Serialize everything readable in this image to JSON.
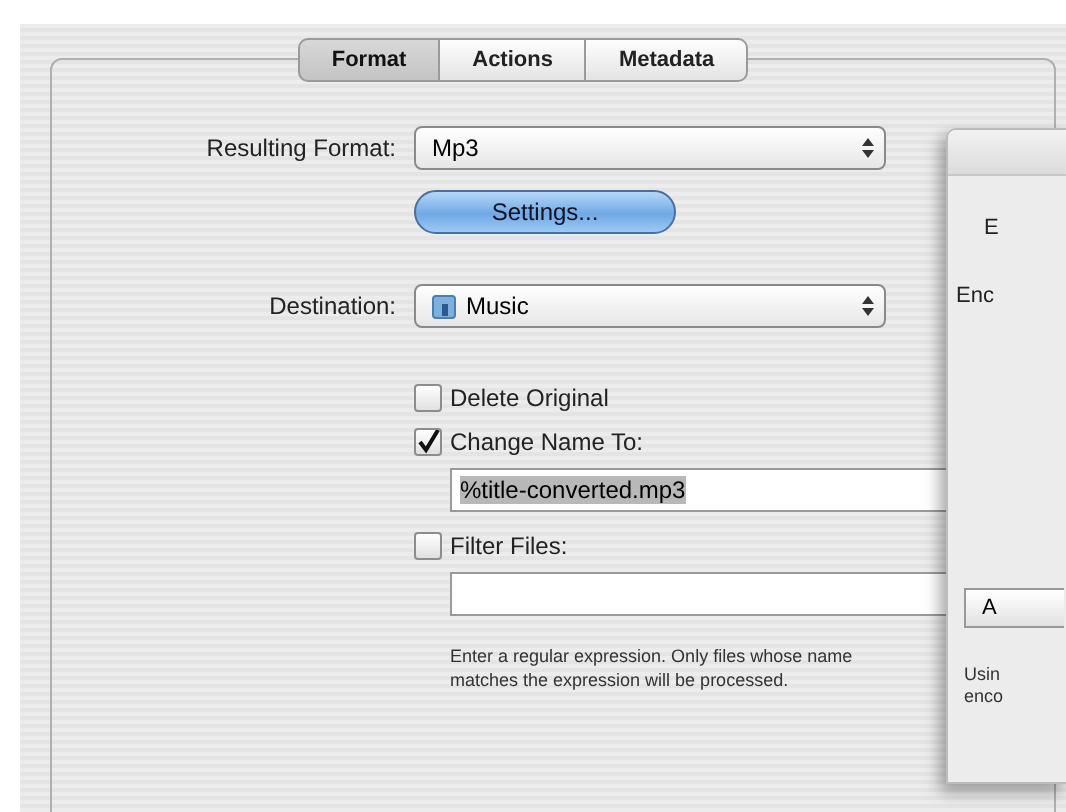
{
  "tabs": [
    {
      "label": "Format",
      "selected": true
    },
    {
      "label": "Actions",
      "selected": false
    },
    {
      "label": "Metadata",
      "selected": false
    }
  ],
  "resulting_format": {
    "label": "Resulting Format:",
    "value": "Mp3"
  },
  "settings_button": "Settings...",
  "destination": {
    "label": "Destination:",
    "value": "Music"
  },
  "options": [
    {
      "kind": "checkbox",
      "label": "Delete Original",
      "checked": false
    },
    {
      "kind": "checkbox",
      "label": "Change Name To:",
      "checked": true
    },
    {
      "kind": "field",
      "value": "%title-converted.mp3",
      "text_selected": true
    },
    {
      "kind": "checkbox",
      "label": "Filter Files:",
      "checked": false
    },
    {
      "kind": "field"
    }
  ],
  "help_text": "Enter a regular expression. Only files whose name matches the expression will be processed.",
  "sheet": {
    "texts": [
      "E",
      "Enc"
    ],
    "button": "A",
    "note_lines": [
      "Usin",
      "enco"
    ]
  }
}
